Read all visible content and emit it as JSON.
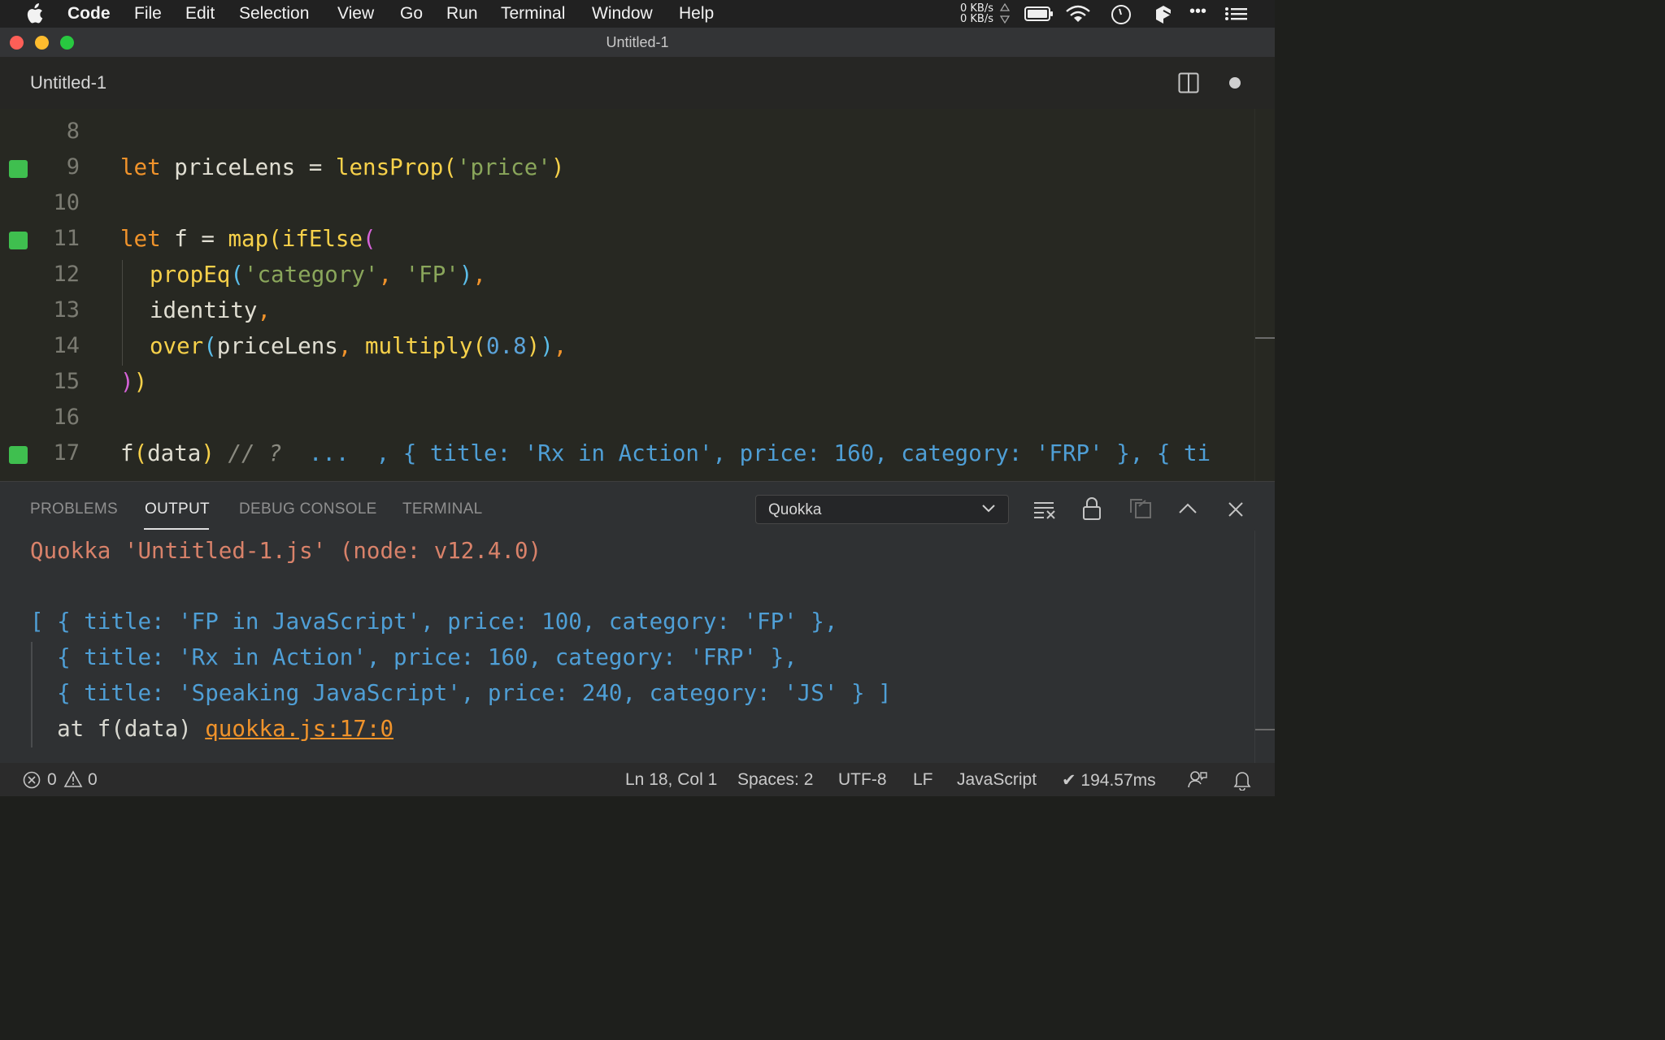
{
  "menubar": {
    "app_name": "Code",
    "items": [
      "File",
      "Edit",
      "Selection",
      "View",
      "Go",
      "Run",
      "Terminal",
      "Window",
      "Help"
    ],
    "net_up": "0 KB/s",
    "net_down": "0 KB/s",
    "more": "•••"
  },
  "window": {
    "title": "Untitled-1"
  },
  "tab": {
    "label": "Untitled-1"
  },
  "editor": {
    "line_numbers": [
      "8",
      "9",
      "10",
      "11",
      "12",
      "13",
      "14",
      "15",
      "16",
      "17"
    ],
    "code": {
      "l9": {
        "kw": "let",
        "var": " priceLens = ",
        "fn": "lensProp",
        "open": "(",
        "str": "'price'",
        "close": ")"
      },
      "l11": {
        "kw": "let",
        "var": " f = ",
        "fn1": "map",
        "open1": "(",
        "fn2": "ifElse",
        "open2": "("
      },
      "l12": {
        "fn": "propEq",
        "open": "(",
        "str1": "'category'",
        "comma": ", ",
        "str2": "'FP'",
        "close": ")",
        "trail": ","
      },
      "l13": {
        "text": "identity",
        "trail": ","
      },
      "l14": {
        "fn1": "over",
        "open1": "(",
        "arg": "priceLens",
        "comma": ", ",
        "fn2": "multiply",
        "open2": "(",
        "num": "0.8",
        "close2": ")",
        "close1": ")",
        "trail": ","
      },
      "l15": {
        "close1": ")",
        "close2": ")"
      },
      "l17": {
        "fn": "f",
        "open": "(",
        "arg": "data",
        "close": ")",
        "comment": " // ? ",
        "inline_value": " ...  , { title: 'Rx in Action', price: 160, category: 'FRP' }, { ti"
      }
    }
  },
  "panel": {
    "tabs": [
      "PROBLEMS",
      "OUTPUT",
      "DEBUG CONSOLE",
      "TERMINAL"
    ],
    "active_tab": "OUTPUT",
    "channel_select": "Quokka",
    "output": {
      "header": "Quokka 'Untitled-1.js' (node: v12.4.0)",
      "lines": [
        "[ { title: 'FP in JavaScript', price: 100, category: 'FP' },",
        "  { title: 'Rx in Action', price: 160, category: 'FRP' },",
        "  { title: 'Speaking JavaScript', price: 240, category: 'JS' } ]"
      ],
      "at_text": "  at f(data) ",
      "location_link": "quokka.js:17:0"
    }
  },
  "statusbar": {
    "errors": "0",
    "warnings": "0",
    "position": "Ln 18, Col 1",
    "spaces": "Spaces: 2",
    "encoding": "UTF-8",
    "eol": "LF",
    "language": "JavaScript",
    "quokka_time": "✔ 194.57ms"
  },
  "colors": {
    "accent_orange": "#f0932b",
    "quokka_header": "#d9826a",
    "output_value": "#4f9fd6",
    "marker_green": "#3fbf4f"
  }
}
